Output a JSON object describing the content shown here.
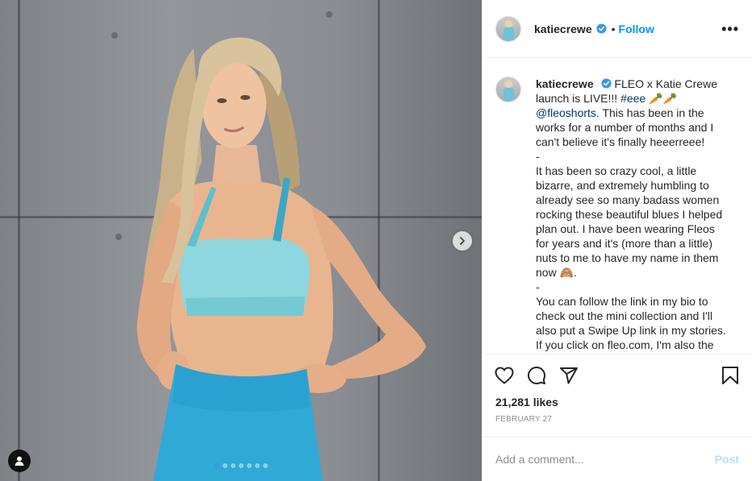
{
  "post": {
    "username": "katiecrewe",
    "separator": "•",
    "follow_label": "Follow",
    "more_label": "•••",
    "caption": {
      "username": "katiecrewe",
      "intro": "FLEO x Katie Crewe launch is LIVE!!!",
      "hashtag": "#eee",
      "emoji_1": "🥕🥕",
      "mention": "@fleoshorts",
      "line_1": ". This has been in the works for a number of months and I can't believe it's finally heeerreee!",
      "dash_1": "-",
      "para_2": "It has been so crazy cool, a little bizarre, and extremely humbling to already see so many badass women rocking these beautiful blues I helped plan out. I have been wearing Fleos for years and it's (more than a little) nuts to me to have my name in them now",
      "emoji_2": "🙈",
      "para_2_end": ".",
      "dash_2": "-",
      "para_3": "You can follow the link in my bio to check out the mini collection and I'll also put a Swipe Up link in my stories. If you click on fleo.com, I'm also the first local women on all the sports take..."
    },
    "likes": "21,281 likes",
    "date": "February 27",
    "comment_placeholder": "Add a comment...",
    "post_label": "Post"
  },
  "media": {
    "slide_count": 7,
    "active_slide": 1,
    "icons": {
      "next": "chevron-right-icon",
      "tag": "user-tag-icon"
    }
  },
  "icons": {
    "like": "heart-icon",
    "comment": "comment-icon",
    "share": "share-icon",
    "save": "bookmark-icon",
    "verified": "verified-badge-icon"
  },
  "colors": {
    "accent": "#0095f6",
    "verified": "#3897f0",
    "post_disabled": "#b2dffc",
    "muted": "#8e8e8e"
  }
}
